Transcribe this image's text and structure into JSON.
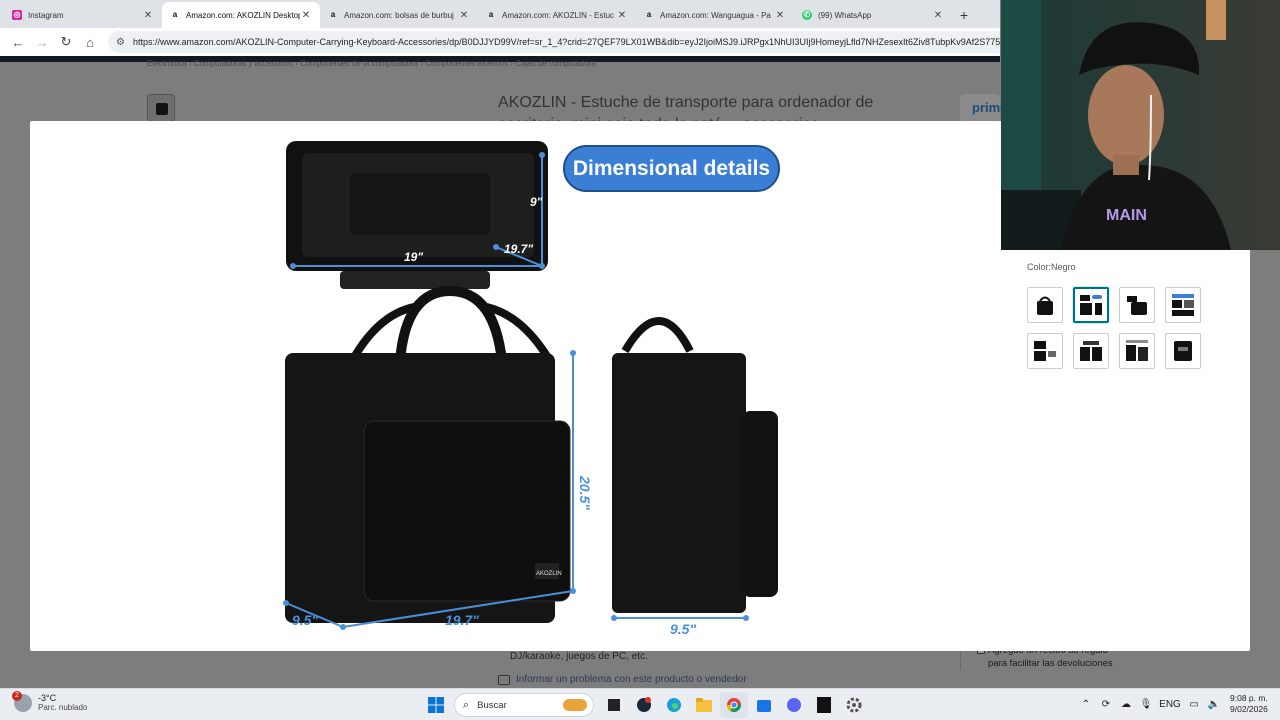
{
  "browser": {
    "tabs": [
      {
        "label": "Instagram",
        "favicon": "instagram-icon",
        "color": "#d6249f",
        "active": false
      },
      {
        "label": "Amazon.com: AKOZLIN Desktop",
        "favicon": "amazon-icon",
        "color": "#111111",
        "active": true
      },
      {
        "label": "Amazon.com: bolsas de burbuj",
        "favicon": "amazon-icon",
        "color": "#111111",
        "active": false
      },
      {
        "label": "Amazon.com: AKOZLIN - Estuc",
        "favicon": "amazon-icon",
        "color": "#111111",
        "active": false
      },
      {
        "label": "Amazon.com: Wanguagua - Pa",
        "favicon": "amazon-icon",
        "color": "#111111",
        "active": false
      },
      {
        "label": "(99) WhatsApp",
        "favicon": "whatsapp-icon",
        "color": "#25d366",
        "active": false
      }
    ],
    "new_tab": "+",
    "url": "https://www.amazon.com/AKOZLIN-Computer-Carrying-Keyboard-Accessories/dp/B0DJJYD99V/ref=sr_1_4?crid=27QEF79LX01WB&dib=eyJ2IjoiMSJ9.iJRPgx1NhUI3UIj9HomeyjLfld7NHZesexIt6Ziv8TubpKv9Af2S775"
  },
  "page": {
    "breadcrumb": "Electrónica › Computadoras y accesorios › Componentes de la computadora › Componentes externos › Cajas de computadora",
    "title": "AKOZLIN - Estuche de transporte para ordenador de escritorio, mini caja todo lo esté… accesorios",
    "prime": "prime",
    "description_tail": "DJ/karaoke, juegos de PC, etc.",
    "report_link": "Informar un problema con este producto o vendedor",
    "gift_text": "Agregue un recibo de regalo para facilitar las devoluciones"
  },
  "modal": {
    "badge": "Dimensional details",
    "dims": {
      "top_depth": "9\"",
      "top_length": "19\"",
      "top_width": "19.7\"",
      "height": "20.5\"",
      "base_depth": "9.5\"",
      "base_width": "19.7\"",
      "side_depth": "9.5\""
    },
    "brand_tag": "AKOZLIN",
    "color_label": "Color:",
    "color_value": "Negro",
    "thumbnails": 8,
    "active_thumbnail": 2
  },
  "taskbar": {
    "weather_temp": "-3°C",
    "weather_desc": "Parc. nublado",
    "notification_count": "2",
    "search_placeholder": "Buscar",
    "language": "ENG",
    "time": "9:08 p. m.",
    "date": "9/02/2026"
  },
  "colors": {
    "accent": "#3b7fd4",
    "dimension_line": "#4a90d9",
    "thumbnail_active": "#007185"
  }
}
